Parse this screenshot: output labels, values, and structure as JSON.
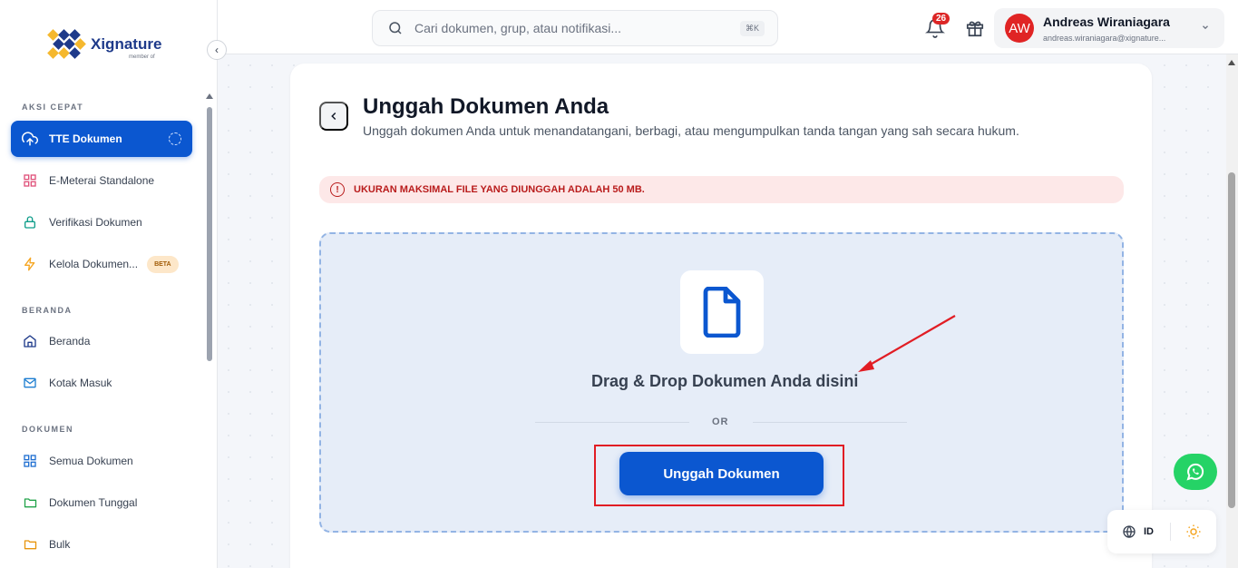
{
  "sidebar": {
    "brand": "Xignature",
    "brand_sub": "member of",
    "sections": [
      {
        "label": "AKSI CEPAT"
      },
      {
        "label": "BERANDA"
      },
      {
        "label": "DOKUMEN"
      }
    ],
    "items": [
      {
        "label": "TTE Dokumen",
        "icon": "cloud-upload-icon"
      },
      {
        "label": "E-Meterai Standalone",
        "icon": "grid-icon"
      },
      {
        "label": "Verifikasi Dokumen",
        "icon": "lock-icon"
      },
      {
        "label": "Kelola Dokumen...",
        "icon": "lightning-icon",
        "badge": "BETA"
      },
      {
        "label": "Beranda",
        "icon": "home-icon"
      },
      {
        "label": "Kotak Masuk",
        "icon": "mail-icon"
      },
      {
        "label": "Semua Dokumen",
        "icon": "grid-icon"
      },
      {
        "label": "Dokumen Tunggal",
        "icon": "folder-icon"
      },
      {
        "label": "Bulk",
        "icon": "folder-icon"
      }
    ]
  },
  "header": {
    "search_placeholder": "Cari dokumen, grup, atau notifikasi...",
    "shortcut": "⌘K",
    "notification_count": "26",
    "user": {
      "initials": "AW",
      "name": "Andreas Wiraniagara",
      "email": "andreas.wiraniagara@xignature..."
    }
  },
  "main": {
    "title": "Unggah Dokumen Anda",
    "subtitle": "Unggah dokumen Anda untuk menandatangani, berbagi, atau mengumpulkan tanda tangan yang sah secara hukum.",
    "alert": "UKURAN MAKSIMAL FILE YANG DIUNGGAH ADALAH 50 MB.",
    "dropzone_text": "Drag & Drop Dokumen Anda disini",
    "or_text": "OR",
    "upload_button": "Unggah Dokumen"
  },
  "footer_widget": {
    "language": "ID"
  },
  "colors": {
    "primary": "#0b57d0",
    "alert_bg": "#fde8e8",
    "alert_text": "#b91c1c",
    "highlight": "#e11d24",
    "whatsapp": "#25d366"
  }
}
